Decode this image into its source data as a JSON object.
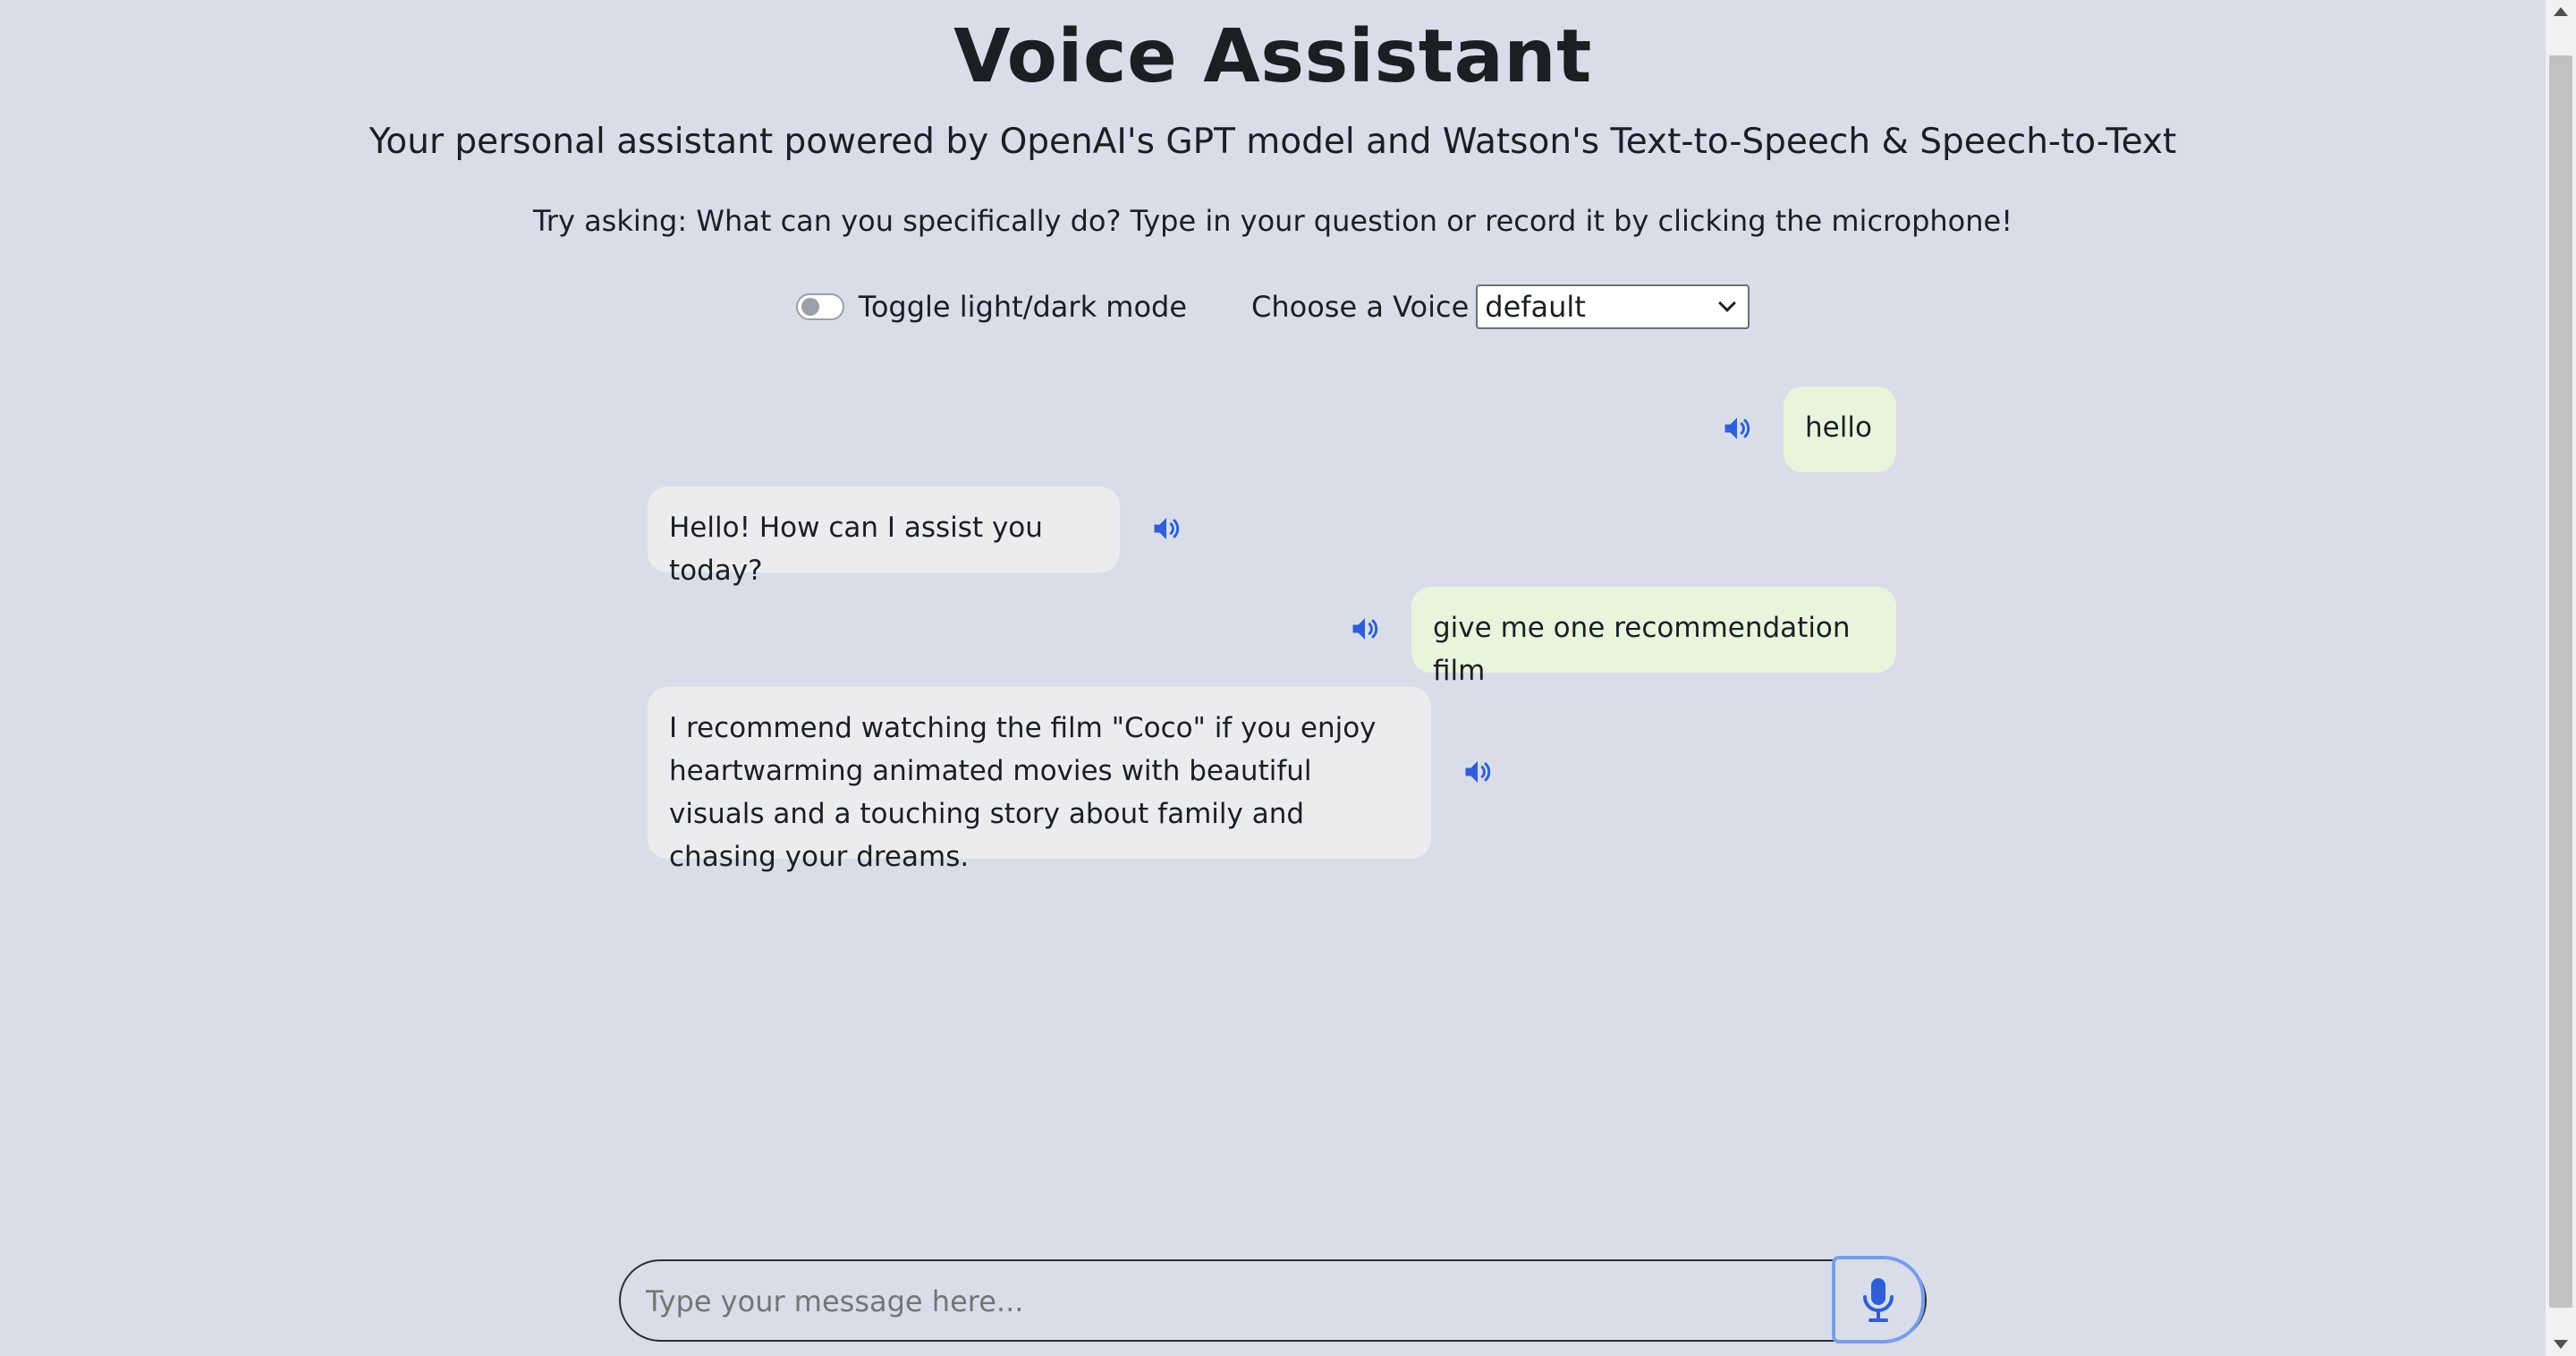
{
  "header": {
    "title": "Voice Assistant",
    "subtitle": "Your personal assistant powered by OpenAI's GPT model and Watson's Text-to-Speech & Speech-to-Text",
    "hint": "Try asking: What can you specifically do? Type in your question or record it by clicking the microphone!"
  },
  "controls": {
    "toggle_label": "Toggle light/dark mode",
    "toggle_on": false,
    "voice_label": "Choose a Voice",
    "voice_selected": "default"
  },
  "chat": {
    "messages": [
      {
        "role": "user",
        "text": "hello"
      },
      {
        "role": "bot",
        "text": "Hello! How can I assist you today?"
      },
      {
        "role": "user",
        "text": "give me one recommendation film"
      },
      {
        "role": "bot",
        "text": "I recommend watching the film \"Coco\" if you enjoy heartwarming animated movies with beautiful visuals and a touching story about family and chasing your dreams."
      }
    ]
  },
  "composer": {
    "placeholder": "Type your message here...",
    "mic_icon": "microphone-icon"
  },
  "colors": {
    "background": "#d8dde9",
    "user_bubble": "#e9f4dc",
    "bot_bubble": "#ececee",
    "speaker_icon": "#2f5fd6",
    "mic_icon": "#2f5fd6"
  }
}
